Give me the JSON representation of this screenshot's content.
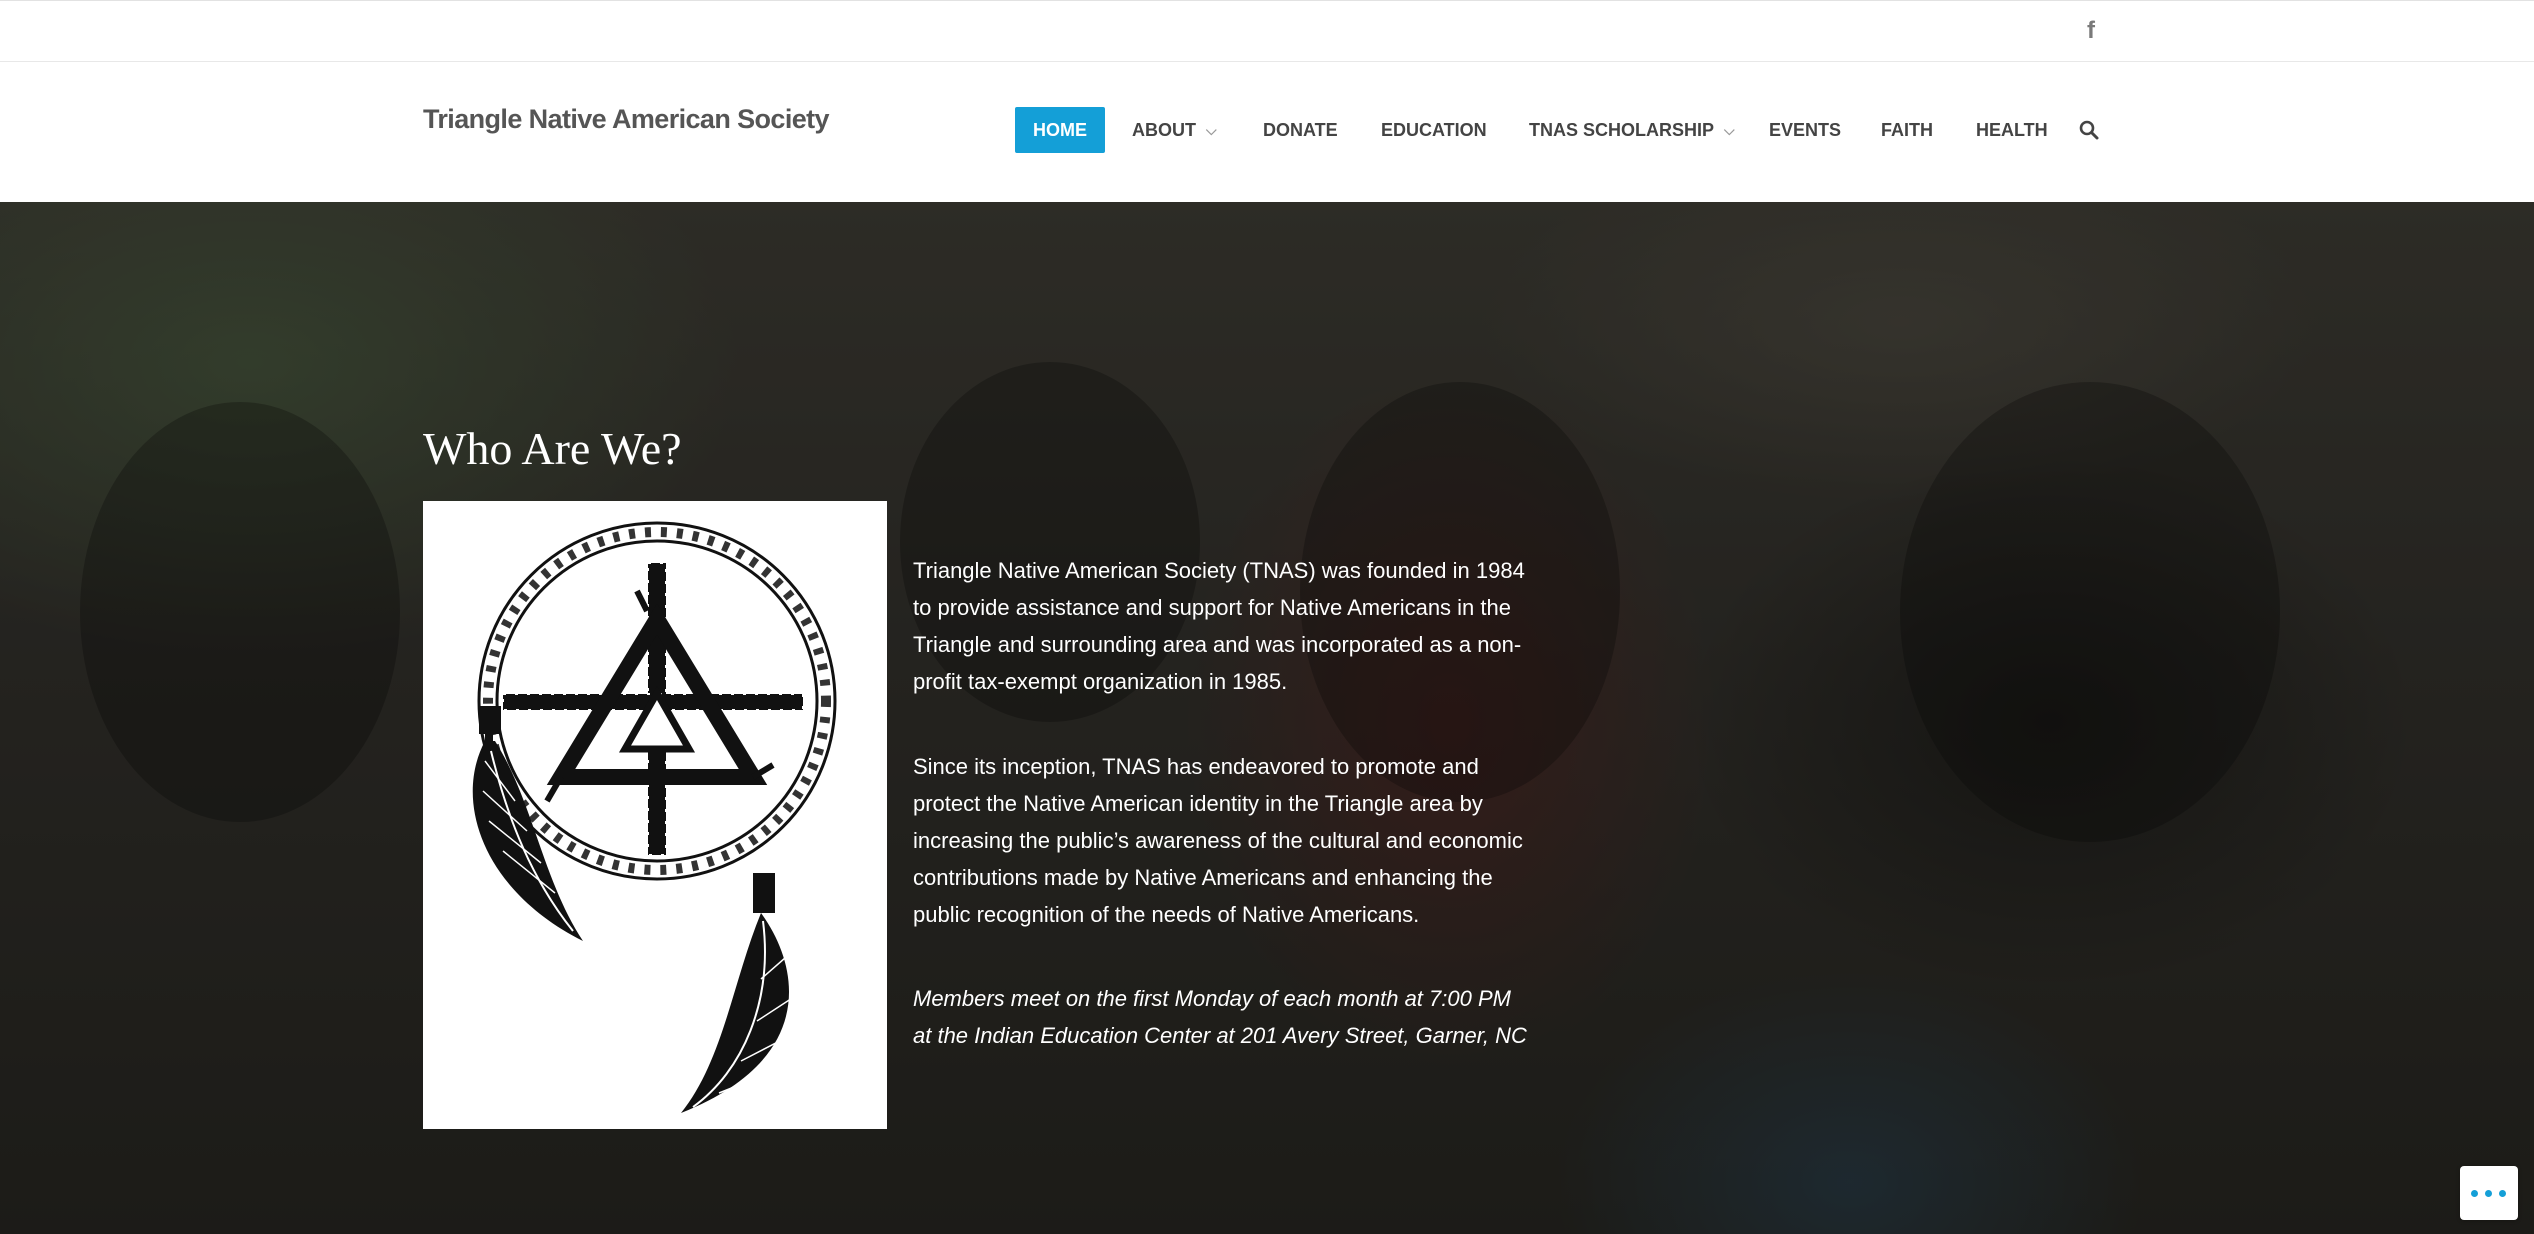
{
  "topbar": {
    "social": [
      {
        "icon": "facebook-icon",
        "glyph": "f"
      }
    ]
  },
  "header": {
    "site_title": "Triangle Native American Society",
    "nav": [
      {
        "label": "HOME",
        "active": true,
        "dropdown": false
      },
      {
        "label": "ABOUT",
        "active": false,
        "dropdown": true
      },
      {
        "label": "DONATE",
        "active": false,
        "dropdown": false
      },
      {
        "label": "EDUCATION",
        "active": false,
        "dropdown": false
      },
      {
        "label": "TNAS SCHOLARSHIP",
        "active": false,
        "dropdown": true
      },
      {
        "label": "EVENTS",
        "active": false,
        "dropdown": false
      },
      {
        "label": "FAITH",
        "active": false,
        "dropdown": false
      },
      {
        "label": "HEALTH",
        "active": false,
        "dropdown": false
      }
    ],
    "search_icon": "search-icon"
  },
  "hero": {
    "heading": "Who Are We?",
    "paragraphs": [
      "Triangle Native American Society (TNAS) was founded in 1984 to provide assistance and support for Native Americans in the Triangle and surrounding area and was incorporated as a non-profit tax-exempt organization in 1985.",
      "Since its inception, TNAS has endeavored to promote and protect the Native American identity in the Triangle area by increasing the public’s awareness of the cultural and economic contributions made by Native Americans and enhancing the public recognition of the needs of Native Americans.",
      "Members meet on the first Monday of each month at 7:00 PM at the Indian Education Center at 201 Avery Street, Garner, NC"
    ]
  },
  "colors": {
    "accent": "#149fd7",
    "nav_text": "#444444",
    "title_text": "#555555"
  }
}
